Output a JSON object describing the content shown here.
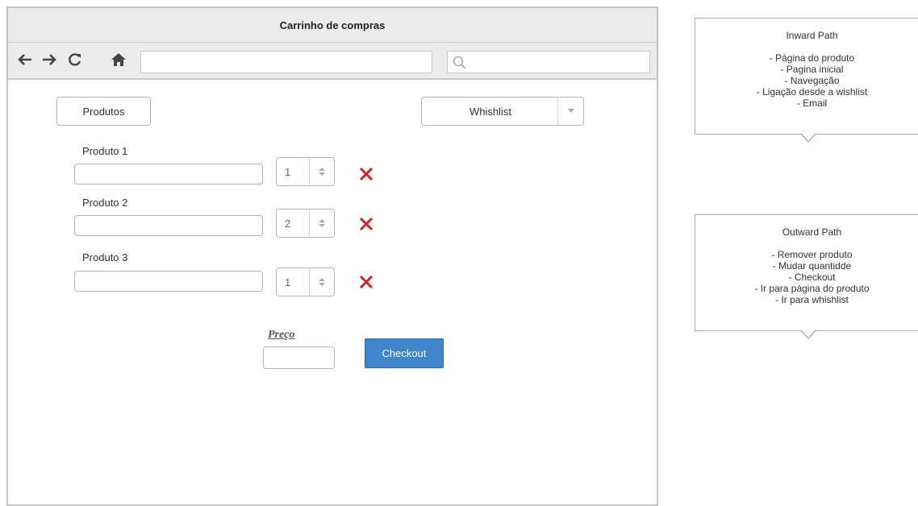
{
  "window": {
    "title": "Carrinho de compras"
  },
  "toolbar": {
    "back_icon": "arrow-left-icon",
    "forward_icon": "arrow-right-icon",
    "reload_icon": "reload-icon",
    "home_icon": "home-icon",
    "url_value": "",
    "search_value": "",
    "search_icon": "search-icon"
  },
  "products_button": {
    "label": "Produtos"
  },
  "whishlist": {
    "selected": "Whishlist"
  },
  "products": [
    {
      "label": "Produto 1",
      "name_value": "",
      "quantity": "1"
    },
    {
      "label": "Produto 2",
      "name_value": "",
      "quantity": "2"
    },
    {
      "label": "Produto 3",
      "name_value": "",
      "quantity": "1"
    }
  ],
  "price": {
    "label": "Preço",
    "value": ""
  },
  "checkout": {
    "label": "Checkout"
  },
  "callouts": {
    "inward": {
      "title": "Inward Path",
      "items": [
        "- Página do produto",
        "- Pagina inicial",
        "- Navegação",
        "- Ligação desde a wishlist",
        "- Email"
      ]
    },
    "outward": {
      "title": "Outward Path",
      "items": [
        "- Remover produto",
        "- Mudar quantidde",
        "- Checkout",
        "- Ir para página do produto",
        "- Ir para whishlist"
      ]
    }
  },
  "colors": {
    "checkout_bg": "#3f85cb",
    "remove_x": "#cc2222",
    "frame": "#c4c4c4"
  }
}
